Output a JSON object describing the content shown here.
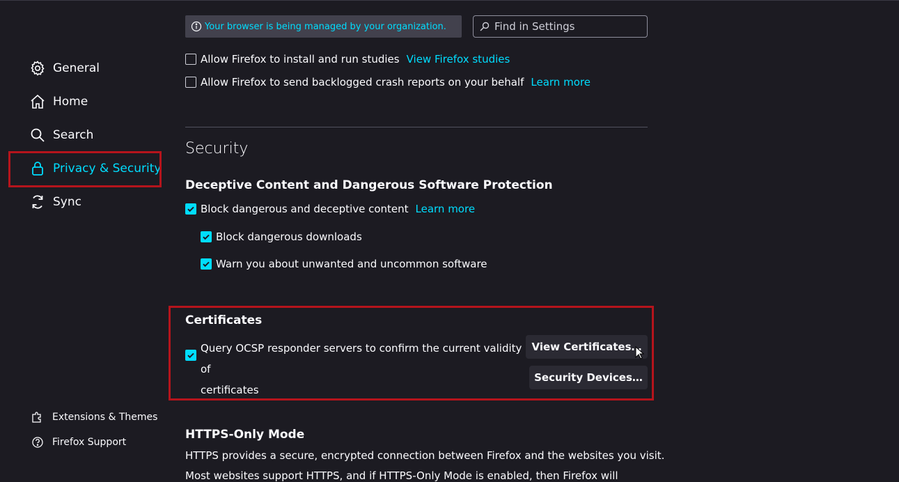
{
  "sidebar": {
    "items": [
      {
        "label": "General",
        "icon": "gear-icon"
      },
      {
        "label": "Home",
        "icon": "home-icon"
      },
      {
        "label": "Search",
        "icon": "search-icon"
      },
      {
        "label": "Privacy & Security",
        "icon": "lock-icon"
      },
      {
        "label": "Sync",
        "icon": "sync-icon"
      }
    ],
    "footer": [
      {
        "label": "Extensions & Themes",
        "icon": "puzzle-icon"
      },
      {
        "label": "Firefox Support",
        "icon": "help-icon"
      }
    ]
  },
  "topbar": {
    "managed_notice": "Your browser is being managed by your organization.",
    "search_placeholder": "Find in Settings"
  },
  "data_collection": {
    "studies_label": "Allow Firefox to install and run studies",
    "studies_link": "View Firefox studies",
    "crash_label": "Allow Firefox to send backlogged crash reports on your behalf",
    "crash_link": "Learn more"
  },
  "security": {
    "title": "Security",
    "deceptive": {
      "heading": "Deceptive Content and Dangerous Software Protection",
      "block_label": "Block dangerous and deceptive content",
      "block_link": "Learn more",
      "downloads_label": "Block dangerous downloads",
      "unwanted_label": "Warn you about unwanted and uncommon software"
    },
    "certificates": {
      "heading": "Certificates",
      "ocsp_line1": "Query OCSP responder servers to confirm the current validity of",
      "ocsp_line2": "certificates",
      "view_button": "View Certificates…",
      "devices_button": "Security Devices…"
    }
  },
  "https_only": {
    "heading": "HTTPS-Only Mode",
    "desc1": "HTTPS provides a secure, encrypted connection between Firefox and the websites you visit.",
    "desc2": "Most websites support HTTPS, and if HTTPS-Only Mode is enabled, then Firefox will"
  },
  "colors": {
    "accent": "#00ddff",
    "background": "#1c1b22",
    "highlight": "#b5141c"
  }
}
